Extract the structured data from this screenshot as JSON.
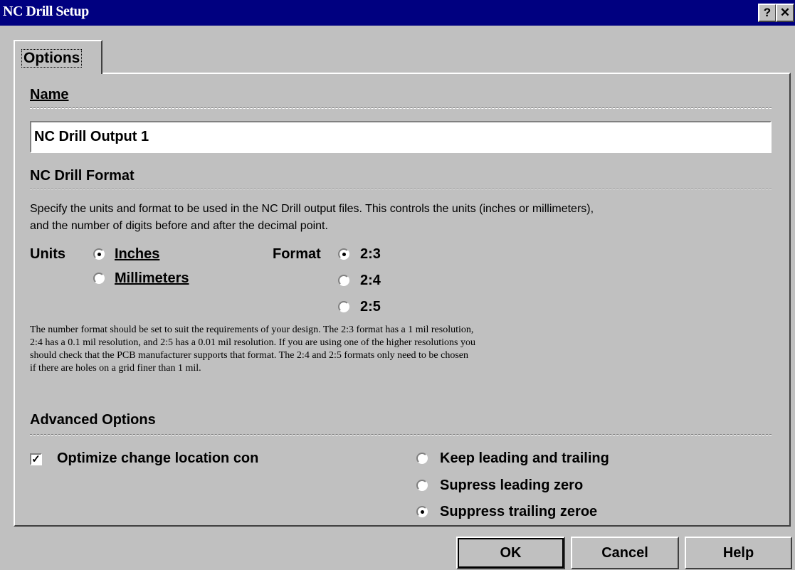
{
  "window": {
    "title": "NC Drill Setup",
    "help_glyph": "?",
    "close_glyph": "✕"
  },
  "tabs": [
    {
      "label": "Options",
      "selected": true
    }
  ],
  "name_section": {
    "heading": "Name",
    "value": "NC Drill Output 1"
  },
  "format_section": {
    "heading": "NC Drill Format",
    "description_line1": "Specify the units and format to be used in the NC Drill output files. This controls the units (inches or millimeters),",
    "description_line2": "and the number of digits before and after the decimal point.",
    "units_label": "Units",
    "units_options": [
      {
        "label": "Inches",
        "checked": true
      },
      {
        "label": "Millimeters",
        "checked": false
      }
    ],
    "format_label": "Format",
    "format_options": [
      {
        "label": "2:3",
        "checked": true
      },
      {
        "label": "2:4",
        "checked": false
      },
      {
        "label": "2:5",
        "checked": false
      }
    ],
    "note_lines": [
      "The number format should be set to suit the requirements of your design. The 2:3 format has a 1 mil resolution,",
      "2:4 has a 0.1 mil resolution, and 2:5 has a 0.01 mil resolution. If you are using one of the higher resolutions you",
      "should check that the PCB manufacturer supports that format. The 2:4 and 2:5 formats only need to be chosen",
      "if there are holes on a grid finer than 1 mil."
    ]
  },
  "advanced_section": {
    "heading": "Advanced Options",
    "optimize_checkbox": {
      "label": "Optimize change location con",
      "checked": true
    },
    "zero_options": [
      {
        "label": "Keep leading and trailing",
        "checked": false
      },
      {
        "label": "Supress leading zero",
        "checked": false
      },
      {
        "label": "Suppress trailing zeroe",
        "checked": true
      }
    ]
  },
  "buttons": {
    "ok": "OK",
    "cancel": "Cancel",
    "help": "Help"
  }
}
